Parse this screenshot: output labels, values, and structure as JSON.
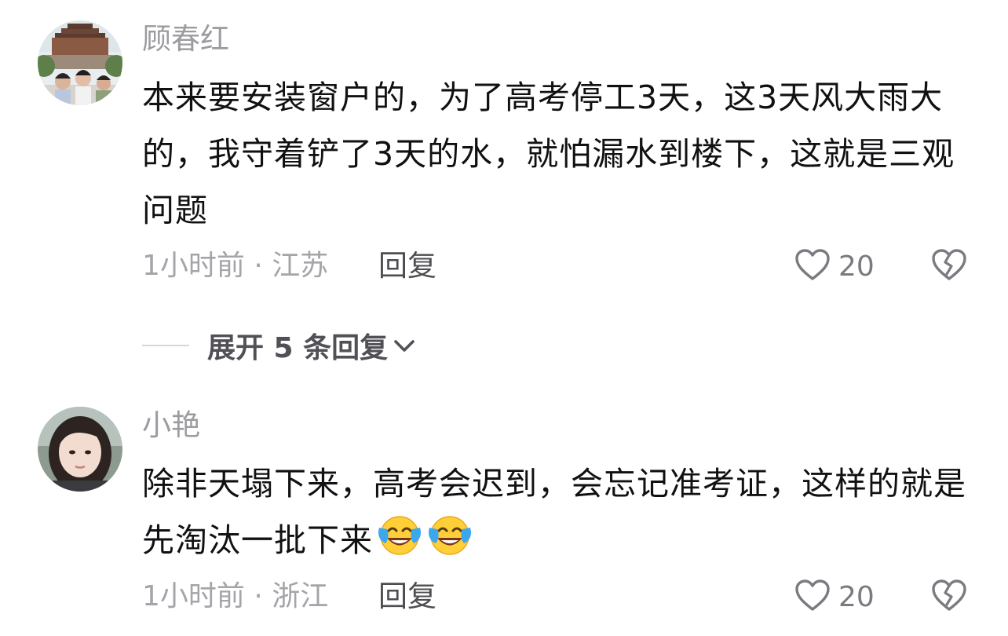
{
  "comments": [
    {
      "username": "顾春红",
      "text": "本来要安装窗户的，为了高考停工3天，这3天风大雨大的，我守着铲了3天的水，就怕漏水到楼下，这就是三观问题",
      "time_location": "1小时前 · 江苏",
      "reply_label": "回复",
      "likes": "20",
      "icons": {
        "like": "heart-outline-icon",
        "dislike": "broken-heart-icon"
      }
    },
    {
      "username": "小艳",
      "text": "除非天塌下来，高考会迟到，会忘记准考证，这样的就是先淘汰一批下来",
      "time_location": "1小时前 · 浙江",
      "reply_label": "回复",
      "likes": "20",
      "icons": {
        "like": "heart-outline-icon",
        "dislike": "broken-heart-icon",
        "emoji": "face-with-tears-of-joy-icon"
      }
    }
  ],
  "expand_replies": {
    "label": "展开 5 条回复",
    "icon": "chevron-down-icon"
  },
  "colors": {
    "username": "#9b9ba0",
    "body_text": "#111114",
    "meta": "#a4a4a9",
    "reply": "#4d4d52",
    "icon": "#7a7a80"
  }
}
